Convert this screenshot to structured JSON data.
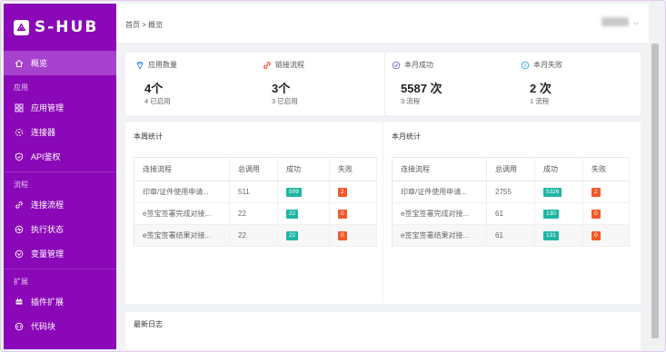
{
  "app": {
    "name": "S-HUB"
  },
  "sidebar": {
    "items": [
      {
        "label": "概览",
        "icon": "home-icon",
        "active": true
      },
      {
        "group": "应用"
      },
      {
        "label": "应用管理",
        "icon": "app-icon"
      },
      {
        "label": "连接器",
        "icon": "connector-icon"
      },
      {
        "label": "API鉴权",
        "icon": "shield-icon"
      },
      {
        "group": "流程"
      },
      {
        "label": "连接流程",
        "icon": "link-icon"
      },
      {
        "label": "执行状态",
        "icon": "status-icon"
      },
      {
        "label": "变量管理",
        "icon": "variable-icon"
      },
      {
        "group": "扩展"
      },
      {
        "label": "插件扩展",
        "icon": "plugin-icon"
      },
      {
        "label": "代码块",
        "icon": "code-icon"
      }
    ]
  },
  "header": {
    "breadcrumb": "首页 > 概览",
    "chevron": "⌵"
  },
  "summary": [
    {
      "label": "应用数量",
      "icon": "diamond-icon",
      "value": "4个",
      "sub": "4 已启用",
      "color": "#3a8ee6"
    },
    {
      "label": "链接流程",
      "icon": "link-icon",
      "value": "3个",
      "sub": "3 已启用",
      "color": "#e0431f"
    },
    {
      "label": "本月成功",
      "icon": "check-circle-icon",
      "value": "5587 次",
      "sub": "3 流程",
      "color": "#6f6fd8"
    },
    {
      "label": "本月失败",
      "icon": "alert-circle-icon",
      "value": "2 次",
      "sub": "1 流程",
      "color": "#3aa6d6"
    }
  ],
  "weekly": {
    "title": "本周统计",
    "headers": [
      "连接流程",
      "总调用",
      "成功",
      "失败"
    ],
    "rows": [
      {
        "name": "印章/证件使用申请...",
        "total": "511",
        "ok": "509",
        "fail": "2"
      },
      {
        "name": "e签宝签署完成对接...",
        "total": "22",
        "ok": "22",
        "fail": "0"
      },
      {
        "name": "e签宝签署结果对接...",
        "total": "22",
        "ok": "22",
        "fail": "0"
      }
    ]
  },
  "monthly": {
    "title": "本月统计",
    "headers": [
      "连接流程",
      "总调用",
      "成功",
      "失败"
    ],
    "rows": [
      {
        "name": "印章/证件使用申请...",
        "total": "2755",
        "ok": "5326",
        "fail": "2"
      },
      {
        "name": "e签宝签署完成对接...",
        "total": "61",
        "ok": "130",
        "fail": "0"
      },
      {
        "name": "e签宝签署结果对接...",
        "total": "61",
        "ok": "131",
        "fail": "0"
      }
    ]
  },
  "log": {
    "title": "最新日志"
  },
  "colors": {
    "sidebar": "#8b08b8",
    "sidebar_active": "#a742cf",
    "success": "#1fb5a3",
    "failure": "#f1592a"
  }
}
